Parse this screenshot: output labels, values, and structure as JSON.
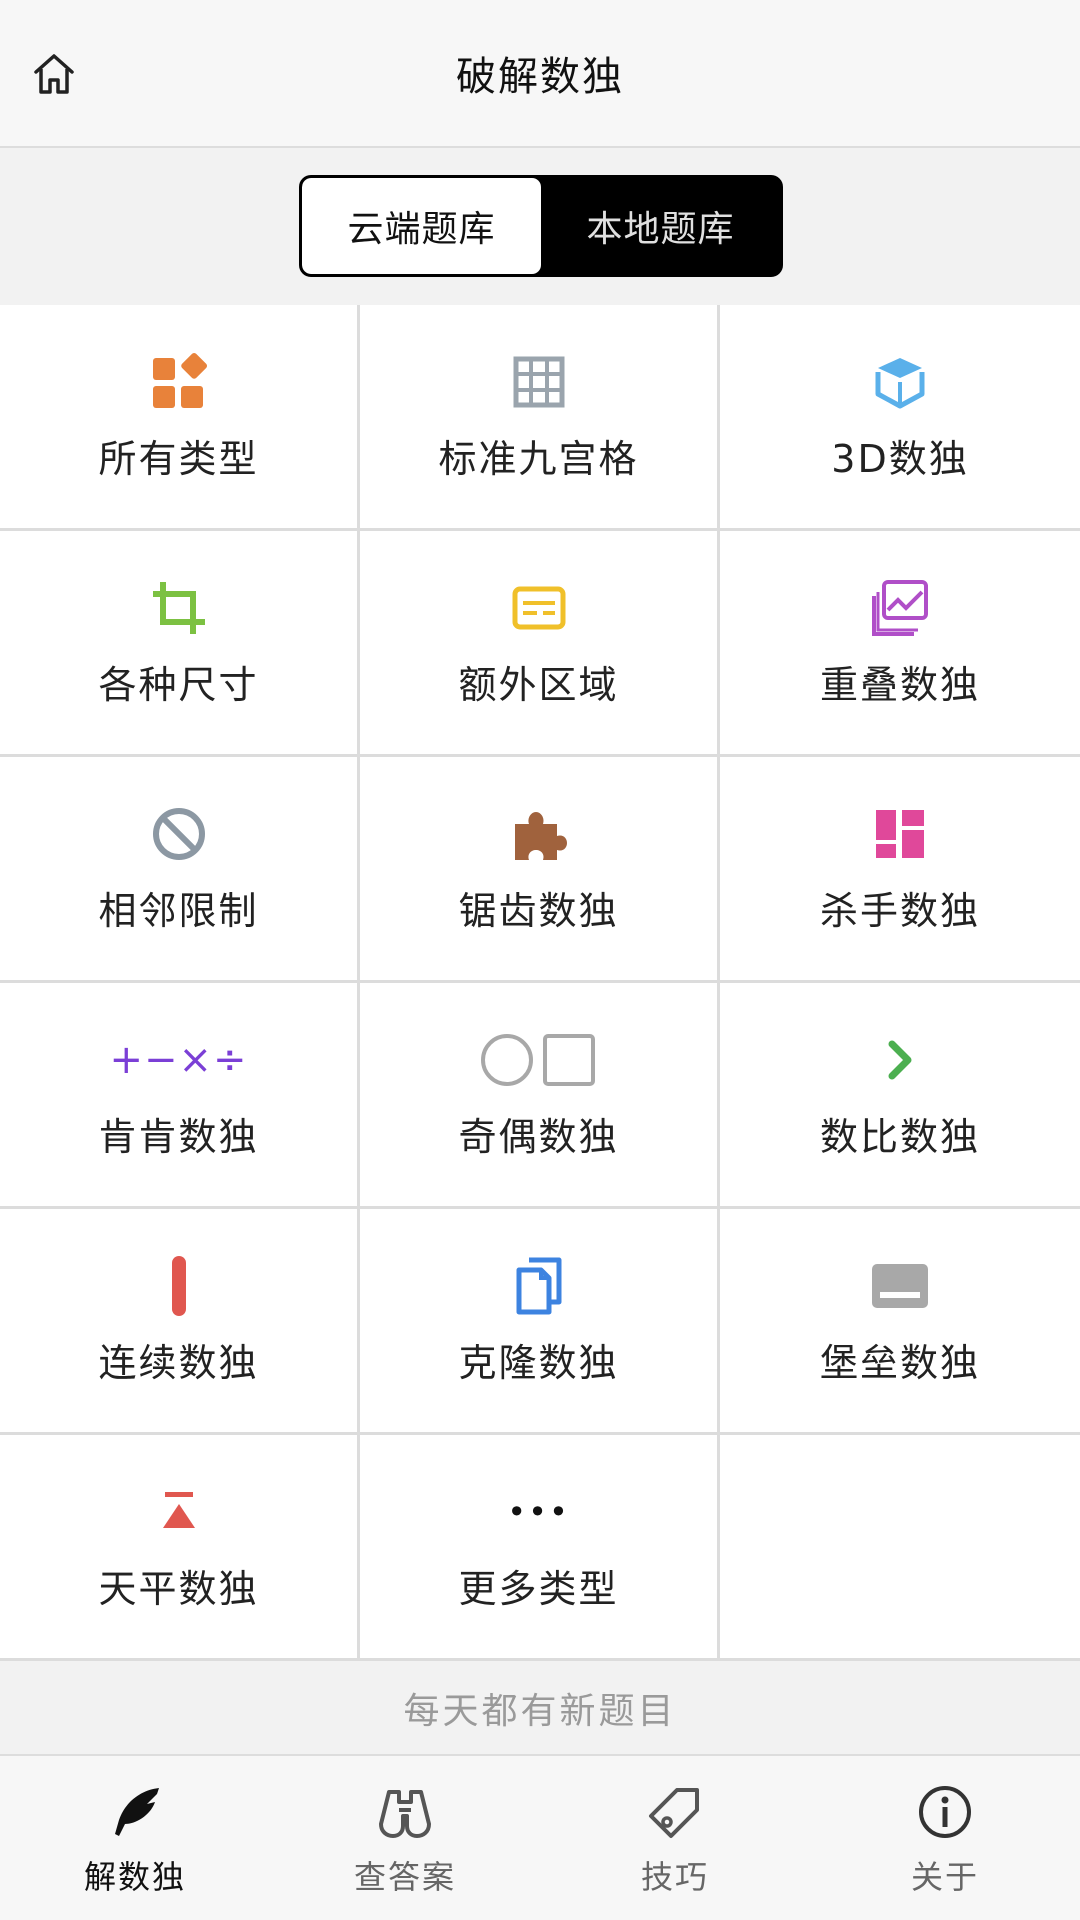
{
  "header": {
    "title": "破解数独",
    "home_icon": "home-icon"
  },
  "segmented": {
    "tabs": [
      {
        "label": "云端题库",
        "active": true
      },
      {
        "label": "本地题库",
        "active": false
      }
    ]
  },
  "grid": {
    "items": [
      {
        "label": "所有类型",
        "icon": "apps-icon",
        "color": "#e8823a"
      },
      {
        "label": "标准九宫格",
        "icon": "grid-icon",
        "color": "#9aa4ad"
      },
      {
        "label": "3D数独",
        "icon": "cube-icon",
        "color": "#5ab0ea"
      },
      {
        "label": "各种尺寸",
        "icon": "crop-icon",
        "color": "#7cc142"
      },
      {
        "label": "额外区域",
        "icon": "card-icon",
        "color": "#f0c02a"
      },
      {
        "label": "重叠数独",
        "icon": "overlap-images-icon",
        "color": "#b04fc8"
      },
      {
        "label": "相邻限制",
        "icon": "ban-icon",
        "color": "#8c98a3"
      },
      {
        "label": "锯齿数独",
        "icon": "puzzle-icon",
        "color": "#a0623d"
      },
      {
        "label": "杀手数独",
        "icon": "dashboard-icon",
        "color": "#e0489a"
      },
      {
        "label": "肯肯数独",
        "icon": "arithmetic-icon",
        "glyph": "+−×÷",
        "color": "#7b3fd6"
      },
      {
        "label": "奇偶数独",
        "icon": "circle-square-icon",
        "color": "#a8a8a8"
      },
      {
        "label": "数比数独",
        "icon": "chevron-right-icon",
        "color": "#4caf50"
      },
      {
        "label": "连续数独",
        "icon": "vertical-bar-icon",
        "color": "#e0574f"
      },
      {
        "label": "克隆数独",
        "icon": "copy-icon",
        "color": "#3d83e0"
      },
      {
        "label": "堡垒数独",
        "icon": "keyboard-icon",
        "color": "#a8a8a8"
      },
      {
        "label": "天平数独",
        "icon": "balance-icon",
        "color": "#e0574f"
      },
      {
        "label": "更多类型",
        "icon": "more-icon",
        "glyph": "•••",
        "color": "#111111"
      }
    ]
  },
  "note": {
    "text": "每天都有新题目"
  },
  "tabbar": {
    "tabs": [
      {
        "label": "解数独",
        "icon": "quill-icon",
        "active": true
      },
      {
        "label": "查答案",
        "icon": "binoculars-icon",
        "active": false
      },
      {
        "label": "技巧",
        "icon": "tag-icon",
        "active": false
      },
      {
        "label": "关于",
        "icon": "info-icon",
        "active": false
      }
    ]
  }
}
